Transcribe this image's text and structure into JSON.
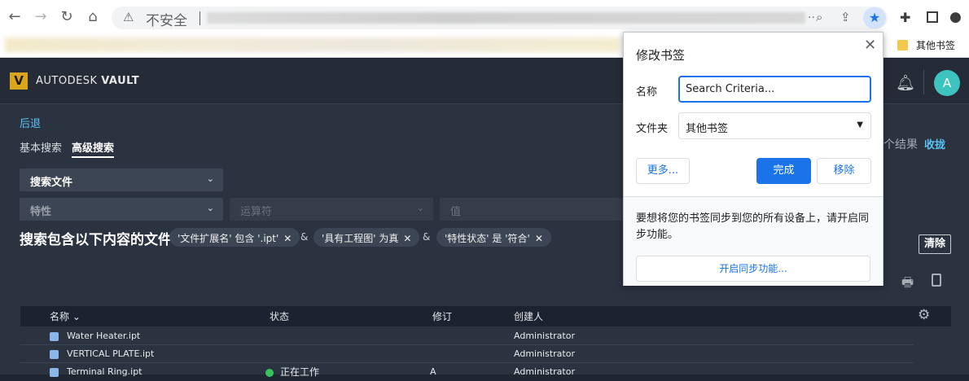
{
  "browser": {
    "back_icon": "arrow-left-icon",
    "insecure_label": "不安全",
    "url_ellipsis": "..",
    "bookmarks_folder_label": "其他书签"
  },
  "app": {
    "logo_letter": "V",
    "brand_prefix": "AUTODESK",
    "brand_name": "VAULT",
    "avatar_letter": "A"
  },
  "search": {
    "back_label": "后退",
    "tabs": [
      {
        "label": "基本搜索",
        "active": false
      },
      {
        "label": "高级搜索",
        "active": true
      }
    ],
    "results_text": "个结果",
    "collapse_label": "收拢",
    "scope_select": "搜索文件",
    "property_placeholder": "特性",
    "operator_placeholder": "运算符",
    "value_placeholder": "值",
    "criteria_title": "搜索包含以下内容的文件",
    "criteria_chips": [
      "'文件扩展名' 包含 '.ipt'",
      "'具有工程图' 为真",
      "'特性状态' 是 '符合'"
    ],
    "and_symbol": "&",
    "clear_label": "清除"
  },
  "table": {
    "columns": [
      "名称",
      "状态",
      "修订",
      "创建人"
    ],
    "rows": [
      {
        "name": "Water Heater.ipt",
        "status": "",
        "revision": "",
        "creator": "Administrator"
      },
      {
        "name": "VERTICAL PLATE.ipt",
        "status": "",
        "revision": "",
        "creator": "Administrator"
      },
      {
        "name": "Terminal Ring.ipt",
        "status": "正在工作",
        "revision": "A",
        "creator": "Administrator"
      }
    ]
  },
  "bookmark_popup": {
    "title": "修改书签",
    "name_label": "名称",
    "name_value": "Search Criteria...",
    "folder_label": "文件夹",
    "folder_value": "其他书签",
    "more_label": "更多...",
    "done_label": "完成",
    "remove_label": "移除",
    "sync_text": "要想将您的书签同步到您的所有设备上，请开启同步功能。",
    "sync_button": "开启同步功能..."
  },
  "colors": {
    "accent_blue": "#1a73e8",
    "link_cyan": "#5ac4f6",
    "vault_gold": "#d9a51c",
    "status_green": "#37c35a"
  }
}
